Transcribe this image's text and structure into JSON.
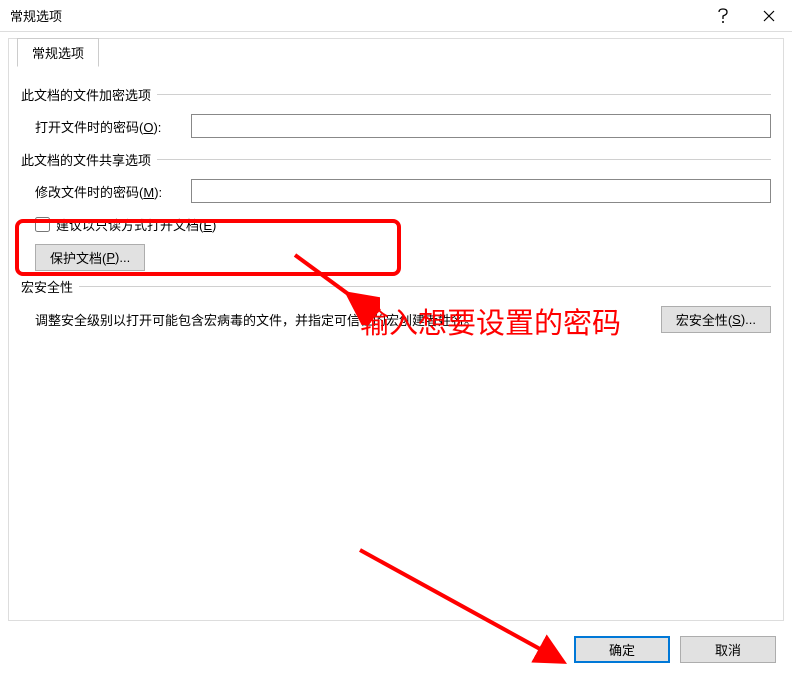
{
  "window": {
    "title": "常规选项"
  },
  "tab": {
    "label": "常规选项"
  },
  "groups": {
    "encrypt": {
      "title": "此文档的文件加密选项",
      "open_password_label_pre": "打开文件时的密码(",
      "open_password_key": "O",
      "open_password_label_post": "):",
      "open_password_value": ""
    },
    "share": {
      "title": "此文档的文件共享选项",
      "modify_password_label_pre": "修改文件时的密码(",
      "modify_password_key": "M",
      "modify_password_label_post": "):",
      "modify_password_value": "",
      "readonly_label_pre": "建议以只读方式打开文档(",
      "readonly_key": "E",
      "readonly_label_post": ")",
      "protect_btn_pre": "保护文档(",
      "protect_btn_key": "P",
      "protect_btn_post": ")..."
    },
    "macro": {
      "title": "宏安全性",
      "desc": "调整安全级别以打开可能包含宏病毒的文件，并指定可信任的宏创建者姓名。",
      "btn_pre": "宏安全性(",
      "btn_key": "S",
      "btn_post": ")..."
    }
  },
  "buttons": {
    "ok": "确定",
    "cancel": "取消"
  },
  "annotation": {
    "text": "输入想要设置的密码"
  }
}
